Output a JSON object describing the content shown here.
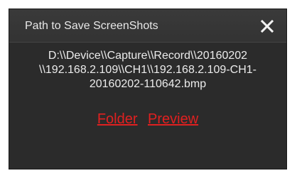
{
  "dialog": {
    "title": "Path to Save ScreenShots",
    "close_icon": "close-icon",
    "path_lines": "D:\\\\Device\\\\Capture\\\\Record\\\\20160202\n\\\\192.168.2.109\\\\CH1\\\\192.168.2.109-CH1-\n20160202-110642.bmp",
    "folder_link": "Folder",
    "preview_link": "Preview"
  },
  "colors": {
    "background": "#2b2b2b",
    "title_bar": "#363636",
    "text": "#ececec",
    "link": "#e02020"
  }
}
